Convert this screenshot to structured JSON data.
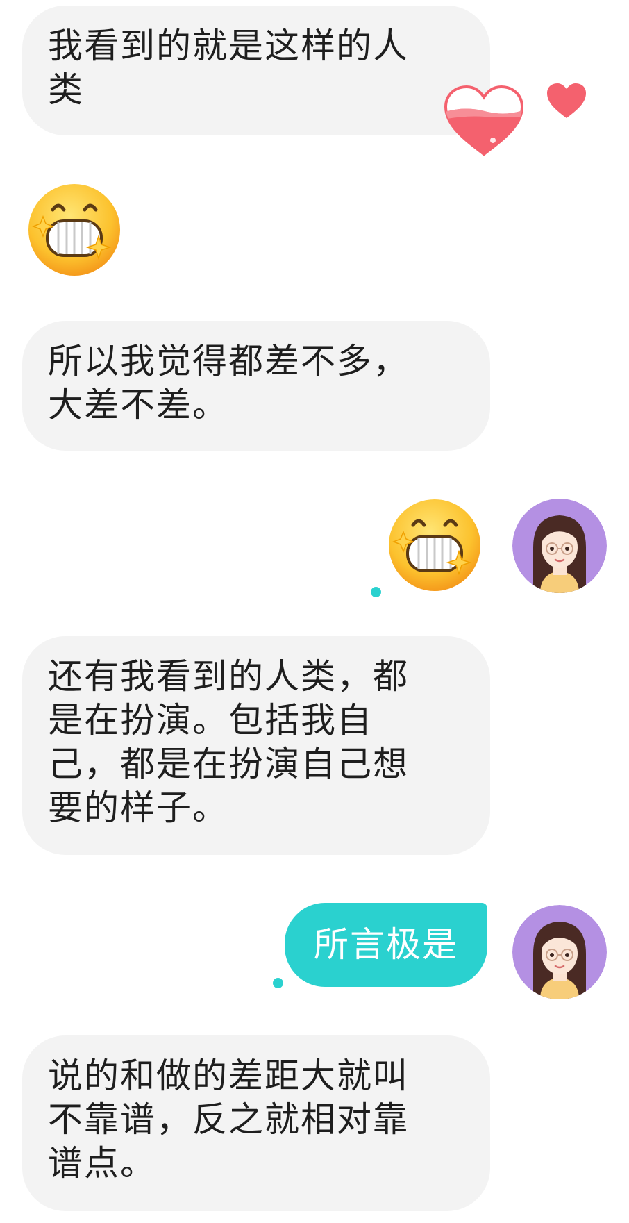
{
  "messages": [
    {
      "text": "我看到的就是这样的人类"
    },
    {
      "text": "所以我觉得都差不多，大差不差。"
    },
    {
      "text": "还有我看到的人类，都是在扮演。包括我自己，都是在扮演自己想要的样子。"
    },
    {
      "text": "所言极是"
    },
    {
      "text": "说的和做的差距大就叫不靠谱，反之就相对靠谱点。"
    }
  ],
  "colors": {
    "incoming_bubble": "#f3f3f3",
    "outgoing_bubble": "#2ad1cf",
    "heart": "#f4616e",
    "avatar_background": "#b490e3"
  }
}
